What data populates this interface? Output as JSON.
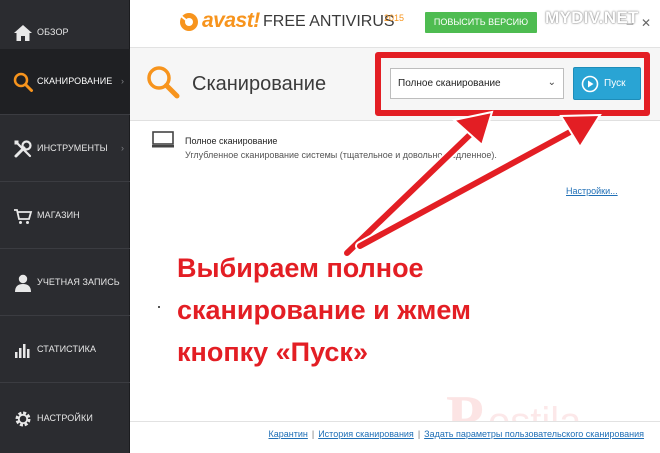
{
  "sidebar": {
    "items": [
      {
        "label": "ОБЗОР",
        "icon": "home-icon"
      },
      {
        "label": "СКАНИРОВАНИЕ",
        "icon": "magnifier-icon",
        "active": true
      },
      {
        "label": "ИНСТРУМЕНТЫ",
        "icon": "tools-icon"
      },
      {
        "label": "МАГАЗИН",
        "icon": "cart-icon"
      },
      {
        "label": "УЧЕТНАЯ ЗАПИСЬ",
        "icon": "user-icon"
      },
      {
        "label": "СТАТИСТИКА",
        "icon": "bar-chart-icon"
      },
      {
        "label": "НАСТРОЙКИ",
        "icon": "gear-icon"
      }
    ]
  },
  "header": {
    "brand": "avast!",
    "product": "FREE ANTIVIRUS",
    "year": "2015",
    "upgrade_label": "ПОВЫСИТЬ ВЕРСИЮ",
    "watermark": "MYDIV.NET"
  },
  "page": {
    "title": "Сканирование",
    "select_value": "Полное сканирование",
    "start_label": "Пуск"
  },
  "option": {
    "title": "Полное сканирование",
    "description": "Углубленное сканирование системы (тщательное и довольно медленное)."
  },
  "settings_link": "Настройки...",
  "callout": {
    "line1": "Выбираем полное",
    "line2": "сканирование и жмем",
    "line3": "кнопку «Пуск»"
  },
  "footer": {
    "link1": "Карантин",
    "link2": "История сканирования",
    "link3": "Задать параметры пользовательского сканирования"
  },
  "colors": {
    "accent_orange": "#f7941d",
    "sidebar_bg": "#2b2c30",
    "highlight_red": "#e31e24",
    "start_blue": "#29a4d4",
    "upgrade_green": "#4ebc51",
    "link_blue": "#1f6fb6"
  }
}
